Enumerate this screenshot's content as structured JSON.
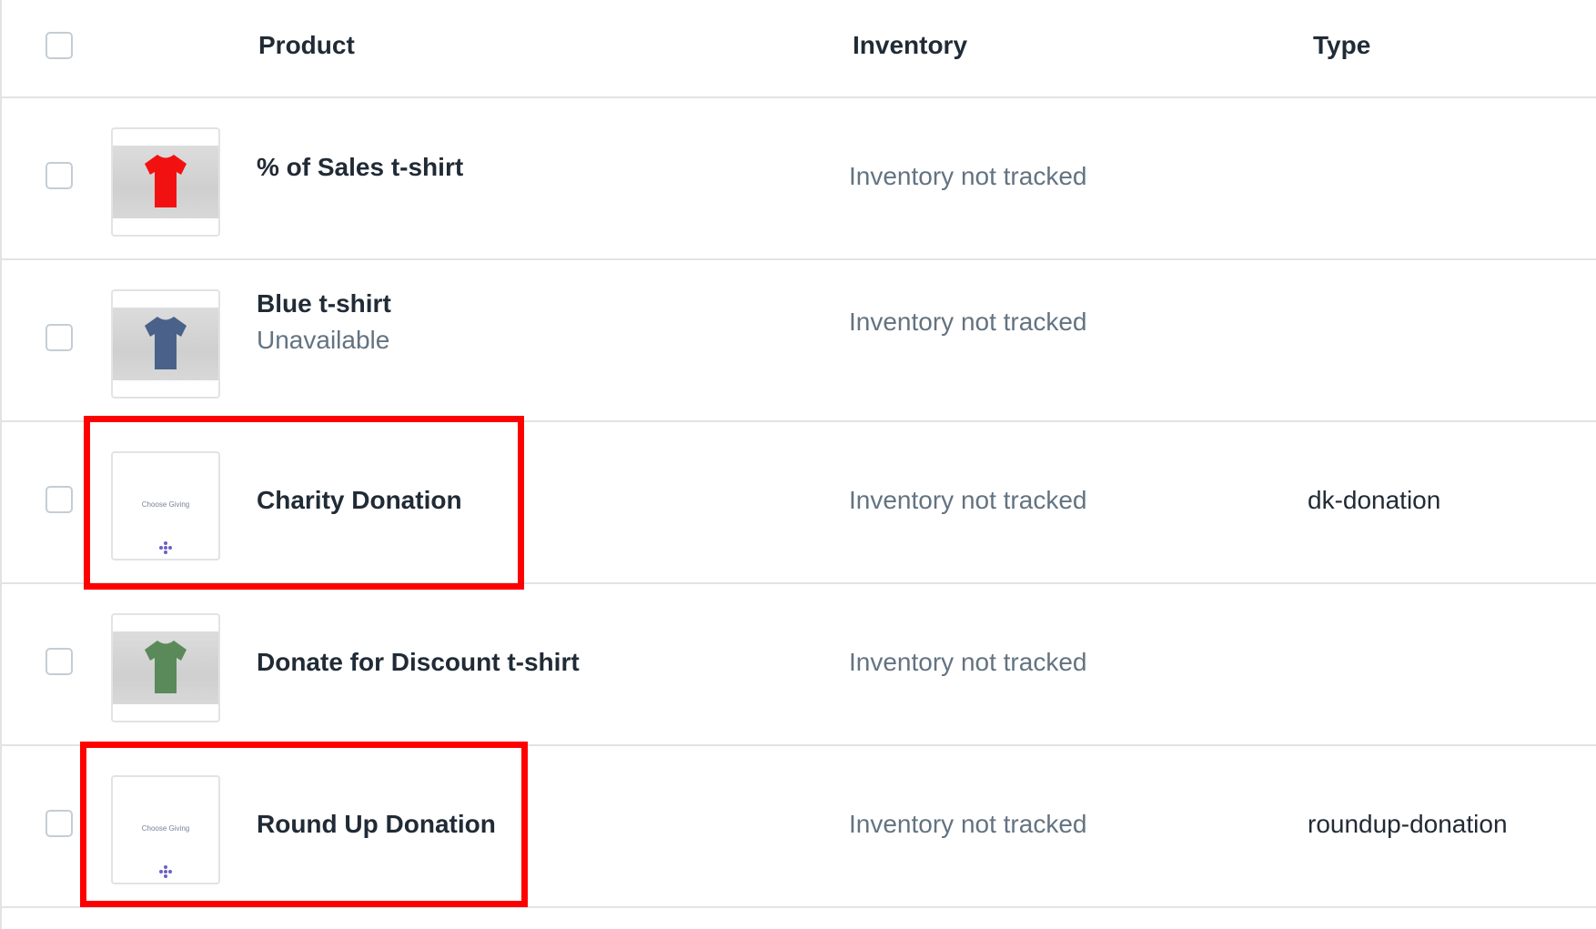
{
  "table": {
    "columns": {
      "product": "Product",
      "inventory": "Inventory",
      "type": "Type"
    },
    "rows": [
      {
        "name": "% of Sales t-shirt",
        "status": "",
        "inventory": "Inventory not tracked",
        "type": "",
        "thumb": "red-tshirt"
      },
      {
        "name": "Blue t-shirt",
        "status": "Unavailable",
        "inventory": "Inventory not tracked",
        "type": "",
        "thumb": "blue-tshirt"
      },
      {
        "name": "Charity Donation",
        "status": "",
        "inventory": "Inventory not tracked",
        "type": "dk-donation",
        "thumb": "choose-giving-logo",
        "thumb_text": "Choose Giving"
      },
      {
        "name": "Donate for Discount t-shirt",
        "status": "",
        "inventory": "Inventory not tracked",
        "type": "",
        "thumb": "green-tshirt"
      },
      {
        "name": "Round Up Donation",
        "status": "",
        "inventory": "Inventory not tracked",
        "type": "roundup-donation",
        "thumb": "choose-giving-logo",
        "thumb_text": "Choose Giving"
      }
    ]
  },
  "colors": {
    "red_tshirt": "#f21111",
    "blue_tshirt": "#4a6189",
    "green_tshirt": "#5a8a5a",
    "highlight": "#ff0000",
    "brand_logo": "#6b62c4"
  }
}
